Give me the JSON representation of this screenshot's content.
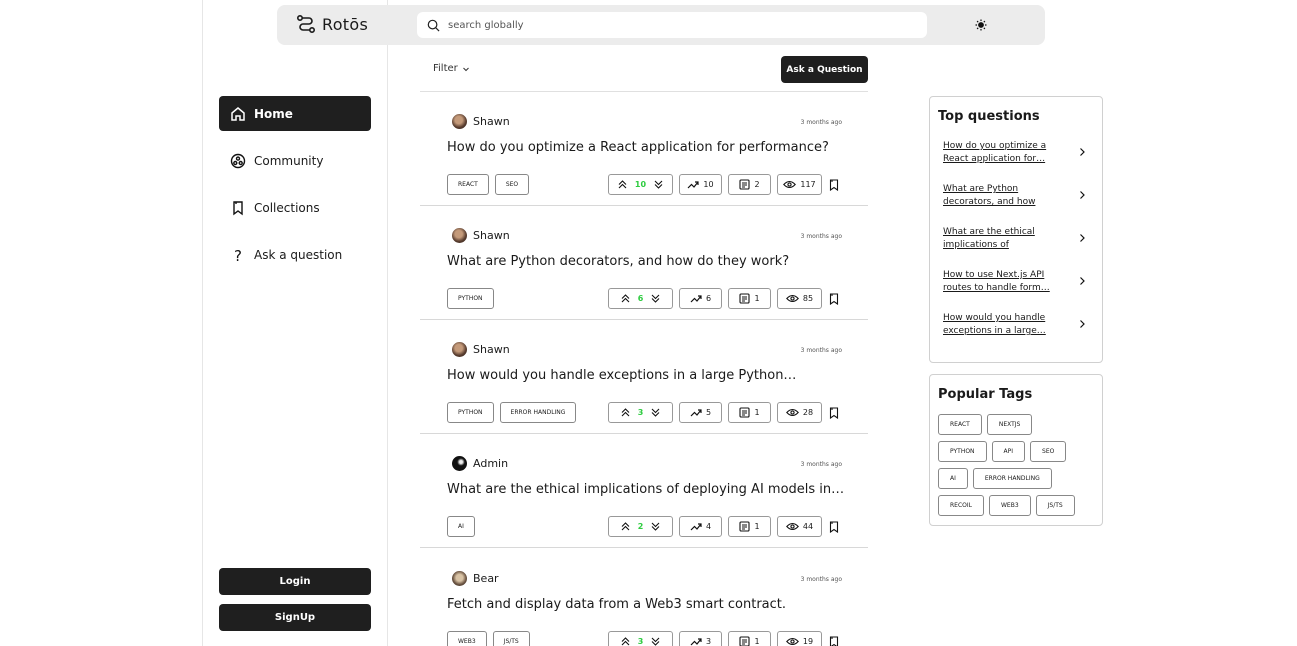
{
  "app": {
    "name": "Rotōs"
  },
  "search": {
    "placeholder": "search globally"
  },
  "nav": {
    "items": [
      {
        "label": "Home",
        "icon": "home-icon",
        "active": true
      },
      {
        "label": "Community",
        "icon": "community-icon"
      },
      {
        "label": "Collections",
        "icon": "bookmark-icon"
      },
      {
        "label": "Ask a question",
        "icon": "question-icon"
      }
    ]
  },
  "auth": {
    "login": "Login",
    "signup": "SignUp"
  },
  "toolbar": {
    "filter": "Filter",
    "ask": "Ask a Question"
  },
  "questions": [
    {
      "author": "Shawn",
      "time": "3 months ago",
      "title": "How do you optimize a React application for performance?",
      "tags": [
        "REACT",
        "SEO"
      ],
      "votes": "10",
      "trend": "10",
      "answers": "2",
      "views": "117"
    },
    {
      "author": "Shawn",
      "time": "3 months ago",
      "title": "What are Python decorators, and how do they work?",
      "tags": [
        "PYTHON"
      ],
      "votes": "6",
      "trend": "6",
      "answers": "1",
      "views": "85"
    },
    {
      "author": "Shawn",
      "time": "3 months ago",
      "title": "How would you handle exceptions in a large Python…",
      "tags": [
        "PYTHON",
        "ERROR HANDLING"
      ],
      "votes": "3",
      "trend": "5",
      "answers": "1",
      "views": "28"
    },
    {
      "author": "Admin",
      "time": "3 months ago",
      "title": "What are the ethical implications of deploying AI models in…",
      "tags": [
        "AI"
      ],
      "votes": "2",
      "trend": "4",
      "answers": "1",
      "views": "44"
    },
    {
      "author": "Bear",
      "time": "3 months ago",
      "title": "Fetch and display data from a Web3 smart contract.",
      "tags": [
        "WEB3",
        "JS/TS"
      ],
      "votes": "3",
      "trend": "3",
      "answers": "1",
      "views": "19"
    }
  ],
  "top_questions": {
    "title": "Top questions",
    "items": [
      "How do you optimize a React application for…",
      "What are Python decorators, and how do…",
      "What are the ethical implications of deploying…",
      "How to use Next.js API routes to handle form…",
      "How would you handle exceptions in a large…"
    ]
  },
  "popular_tags": {
    "title": "Popular Tags",
    "items": [
      "REACT",
      "NEXTJS",
      "PYTHON",
      "API",
      "SEO",
      "AI",
      "ERROR HANDLING",
      "RECOIL",
      "WEB3",
      "JS/TS"
    ]
  },
  "colors": {
    "accent": "#1f1f1f",
    "vote": "#2ecc40",
    "header_bg": "#ececec"
  }
}
